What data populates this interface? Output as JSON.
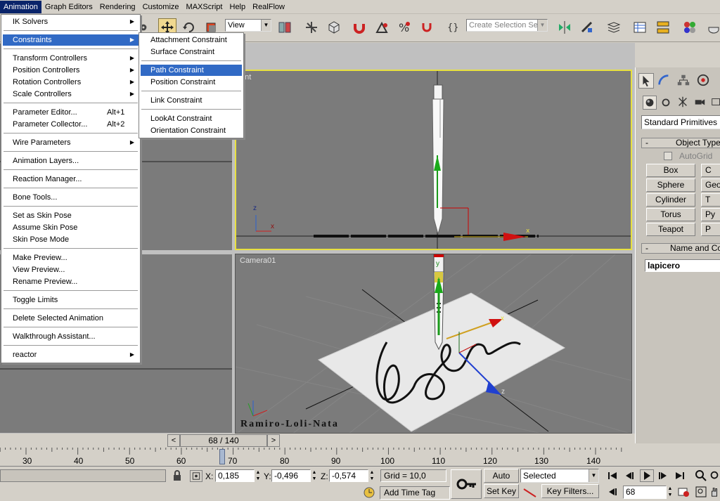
{
  "menubar": {
    "items": [
      "Animation",
      "Graph Editors",
      "Rendering",
      "Customize",
      "MAXScript",
      "Help",
      "RealFlow"
    ]
  },
  "toolbar": {
    "view_combo": "View",
    "selection_set_placeholder": "Create Selection Set"
  },
  "animation_menu": {
    "items": [
      {
        "label": "IK Solvers",
        "sub": true
      },
      {
        "label": "Constraints",
        "sub": true
      },
      {
        "label": "Transform Controllers",
        "sub": true
      },
      {
        "label": "Position Controllers",
        "sub": true
      },
      {
        "label": "Rotation Controllers",
        "sub": true
      },
      {
        "label": "Scale Controllers",
        "sub": true
      },
      {
        "label": "Parameter Editor...",
        "shortcut": "Alt+1"
      },
      {
        "label": "Parameter Collector...",
        "shortcut": "Alt+2"
      },
      {
        "label": "Wire Parameters",
        "sub": true
      },
      {
        "label": "Animation Layers..."
      },
      {
        "label": "Reaction Manager..."
      },
      {
        "label": "Bone Tools..."
      },
      {
        "label": "Set as Skin Pose"
      },
      {
        "label": "Assume Skin Pose"
      },
      {
        "label": "Skin Pose Mode"
      },
      {
        "label": "Make Preview..."
      },
      {
        "label": "View Preview..."
      },
      {
        "label": "Rename Preview..."
      },
      {
        "label": "Toggle Limits"
      },
      {
        "label": "Delete Selected Animation"
      },
      {
        "label": "Walkthrough Assistant..."
      },
      {
        "label": "reactor",
        "sub": true
      }
    ]
  },
  "constraints_menu": {
    "items": [
      "Attachment Constraint",
      "Surface Constraint",
      "Path Constraint",
      "Position Constraint",
      "Link Constraint",
      "LookAt Constraint",
      "Orientation Constraint"
    ]
  },
  "viewports": {
    "front_label": "ont",
    "camera_label": "Camera01",
    "watermark": "Ramiro-Loli-Nata",
    "axis_x": "x",
    "axis_y": "y",
    "axis_z": "z"
  },
  "command_panel": {
    "category": "Standard Primitives",
    "object_type_title": "Object Type",
    "autogrid_label": "AutoGrid",
    "buttons_left": [
      "Box",
      "Sphere",
      "Cylinder",
      "Torus",
      "Teapot"
    ],
    "buttons_right": [
      "C",
      "Geo",
      "T",
      "Py",
      "P"
    ],
    "name_color_title": "Name and Colo",
    "object_name": "lapicero"
  },
  "timeline": {
    "frame_display": "68 / 140",
    "ticks": [
      "30",
      "40",
      "50",
      "60",
      "70",
      "80",
      "90",
      "100",
      "110",
      "120",
      "130",
      "140"
    ],
    "current_frame": 68,
    "total_frames": 140
  },
  "status": {
    "x_label": "X:",
    "x_value": "0,185",
    "y_label": "Y:",
    "y_value": "-0,496",
    "z_label": "Z:",
    "z_value": "-0,574",
    "grid": "Grid = 10,0",
    "auto_key": "Auto Key",
    "set_key": "Set Key",
    "selected": "Selected",
    "key_filters": "Key Filters...",
    "add_time_tag": "Add Time Tag",
    "frame_field": "68"
  }
}
